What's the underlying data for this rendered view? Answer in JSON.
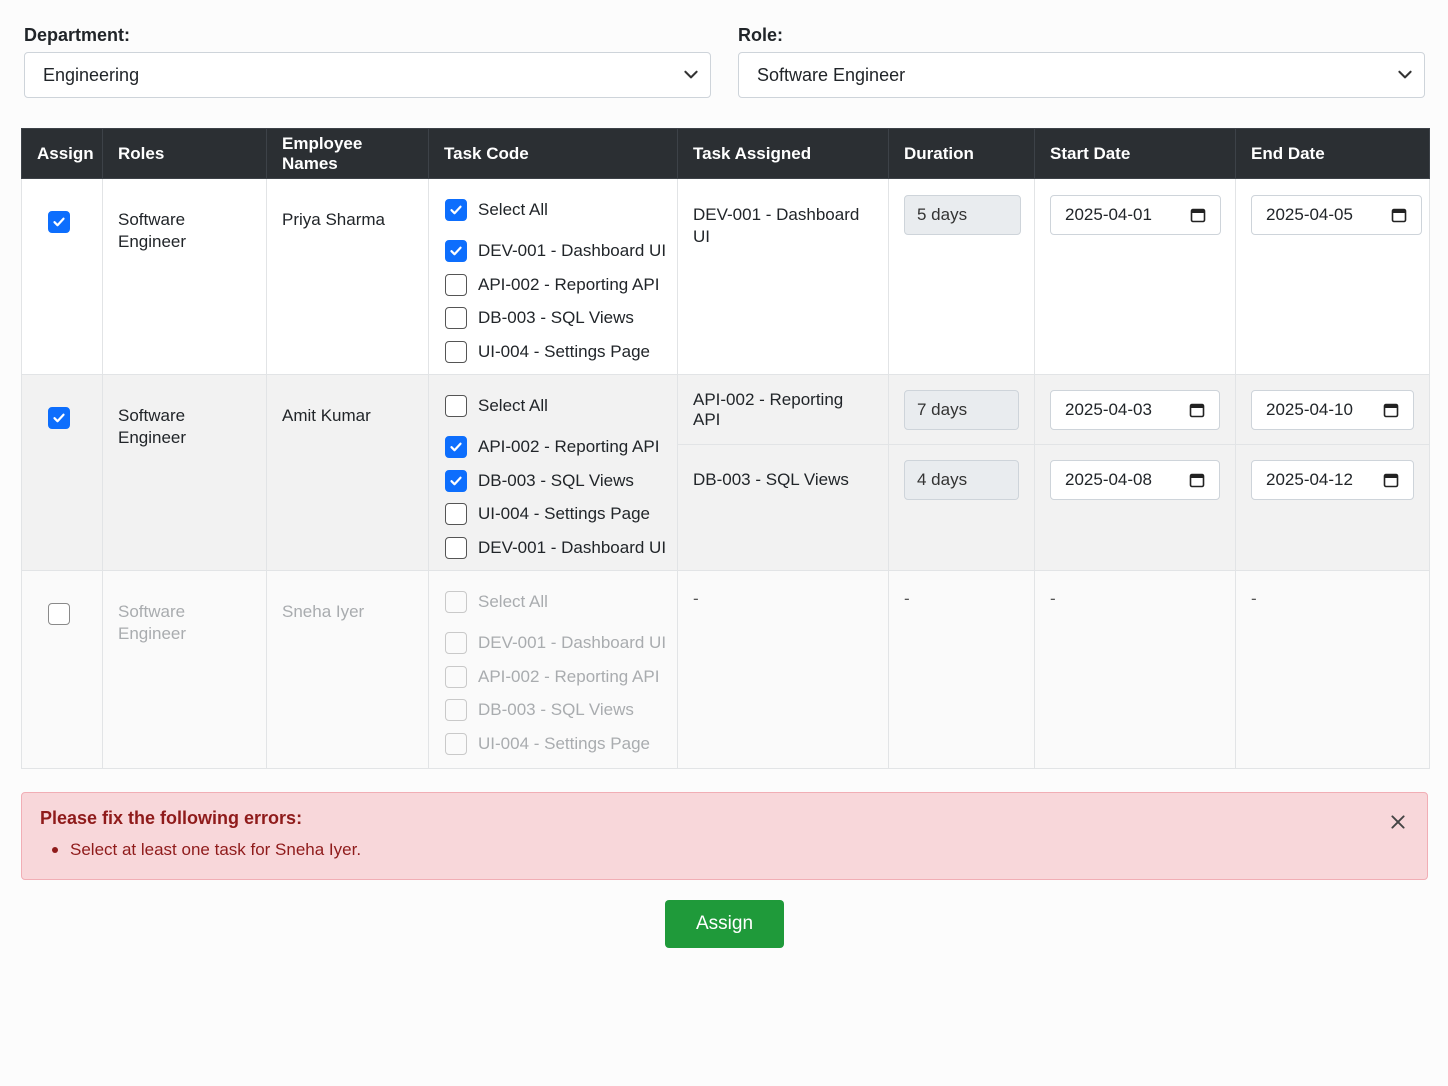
{
  "filters": {
    "department_label": "Department:",
    "department_value": "Engineering",
    "role_label": "Role:",
    "role_value": "Software Engineer"
  },
  "table": {
    "headers": [
      "Assign",
      "Roles",
      "Employee Names",
      "Task Code",
      "Task Assigned",
      "Duration",
      "Start Date",
      "End Date"
    ],
    "rows": [
      {
        "assigned": true,
        "role": "Software Engineer",
        "employee": "Priya Sharma",
        "select_all_label": "Select All",
        "select_all_checked": true,
        "tasks": [
          {
            "label": "DEV-001 - Dashboard UI",
            "checked": true
          },
          {
            "label": "API-002 - Reporting API",
            "checked": false
          },
          {
            "label": "DB-003 - SQL Views",
            "checked": false
          },
          {
            "label": "UI-004 - Settings Page",
            "checked": false
          }
        ],
        "assignments": [
          {
            "task": "DEV-001 - Dashboard UI",
            "duration": "5 days",
            "start": "2025-04-01",
            "end": "2025-04-05"
          }
        ]
      },
      {
        "assigned": true,
        "role": "Software Engineer",
        "employee": "Amit Kumar",
        "select_all_label": "Select All",
        "select_all_checked": false,
        "tasks": [
          {
            "label": "API-002 - Reporting API",
            "checked": true
          },
          {
            "label": "DB-003 - SQL Views",
            "checked": true
          },
          {
            "label": "UI-004 - Settings Page",
            "checked": false
          },
          {
            "label": "DEV-001 - Dashboard UI",
            "checked": false
          }
        ],
        "assignments": [
          {
            "task": "API-002 - Reporting API",
            "duration": "7 days",
            "start": "2025-04-03",
            "end": "2025-04-10"
          },
          {
            "task": "DB-003 - SQL Views",
            "duration": "4 days",
            "start": "2025-04-08",
            "end": "2025-04-12"
          }
        ]
      },
      {
        "assigned": false,
        "role": "Software Engineer",
        "employee": "Sneha Iyer",
        "select_all_label": "Select All",
        "select_all_checked": false,
        "tasks": [
          {
            "label": "DEV-001 - Dashboard UI",
            "checked": false
          },
          {
            "label": "API-002 - Reporting API",
            "checked": false
          },
          {
            "label": "DB-003 - SQL Views",
            "checked": false
          },
          {
            "label": "UI-004 - Settings Page",
            "checked": false
          }
        ],
        "empty": {
          "task": "-",
          "duration": "-",
          "start": "-",
          "end": "-"
        }
      }
    ]
  },
  "alert": {
    "title": "Please fix the following errors:",
    "errors": [
      "Select at least one task for Sneha Iyer."
    ]
  },
  "assign_button": "Assign",
  "colors": {
    "header_bg": "#2b2f33",
    "checkbox_accent": "#0d6efd",
    "alert_bg": "#f8d7da",
    "alert_text": "#8f1b1b",
    "button_bg": "#1f9a3a"
  }
}
